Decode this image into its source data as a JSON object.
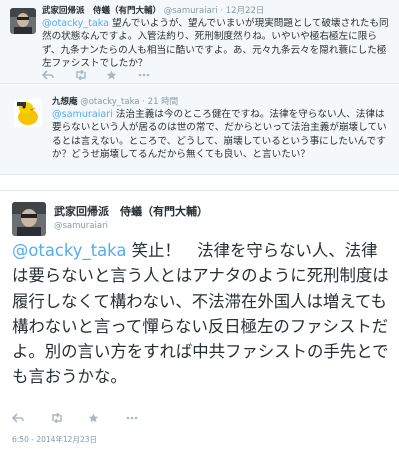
{
  "tweets": [
    {
      "name": "武家回帰派　侍蟻（有門大輔）",
      "handle": "@samuraiari",
      "time": "· 12月22日",
      "mention": "@otacky_taka",
      "text": " 望んでいようが、望んでいまいが現実問題として破壊されたも同然の状態なんですよ。入管法約り、死刑制度然りね。いやいや極右極左に限らず、九条ナンたらの人も相当に酷いですよ。あ、元々九条云々を隠れ蓑にした極左ファシストでしたか？"
    },
    {
      "name": "九想庵",
      "handle": "@otacky_taka",
      "time": "· 21 時間",
      "mention": "@samuraiari",
      "text": " 法治主義は今のところ健在ですね。法律を守らない人、法律は要らないという人が居るのは世の常で、だからといって法治主義が崩壊しているとは言えない。ところで、どうして、崩壊しているという事にしたいんですか？どうせ崩壊してるんだから無くても良い、と言いたい？"
    }
  ],
  "main_tweet": {
    "name": "武家回帰派　侍蟻（有門大輔）",
    "handle": "@samuraiari",
    "mention": "@otacky_taka",
    "text": " 笑止！　法律を守らない人、法律は要らないと言う人とはアナタのように死刑制度は履行しなくて構わない、不法滞在外国人は増えても構わないと言って憚らない反日極左のファシストだよ。別の言い方をすれば中共ファシストの手先とでも言おうかな。",
    "timestamp": "6:50 - 2014年12月23日"
  },
  "colors": {
    "link": "#55acee",
    "muted": "#8899a6",
    "icon": "#aab8c2",
    "reply_bg": "#f5f8fa"
  },
  "icons": [
    "reply-icon",
    "retweet-icon",
    "favorite-icon",
    "more-icon"
  ]
}
